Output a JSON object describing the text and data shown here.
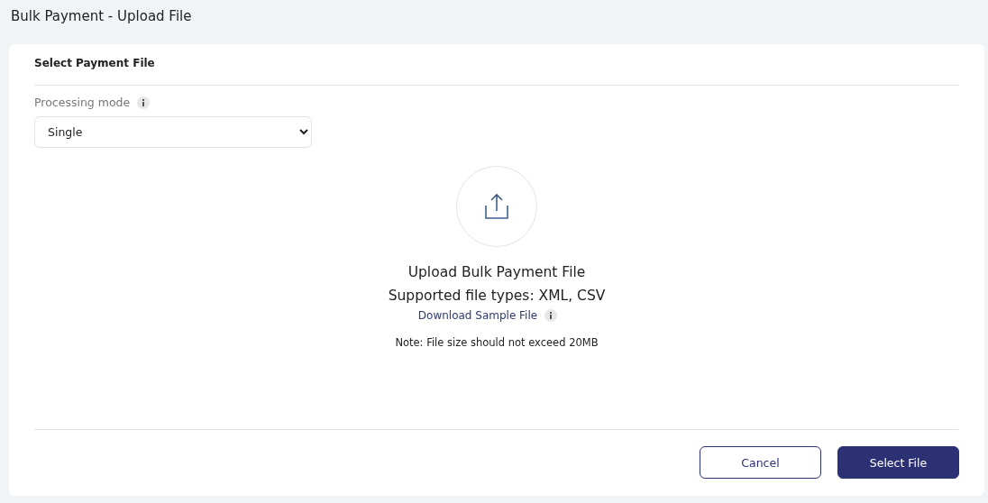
{
  "page_title": "Bulk Payment - Upload File",
  "card": {
    "title": "Select Payment File",
    "processing_mode": {
      "label": "Processing mode",
      "value": "Single"
    },
    "upload": {
      "heading": "Upload Bulk Payment File",
      "file_types": "Supported file types: XML, CSV",
      "sample_link": "Download Sample File",
      "note": "Note: File size should not exceed 20MB"
    },
    "buttons": [
      {
        "label": "Cancel",
        "kind": "secondary"
      },
      {
        "label": "Select File",
        "kind": "primary"
      }
    ]
  }
}
